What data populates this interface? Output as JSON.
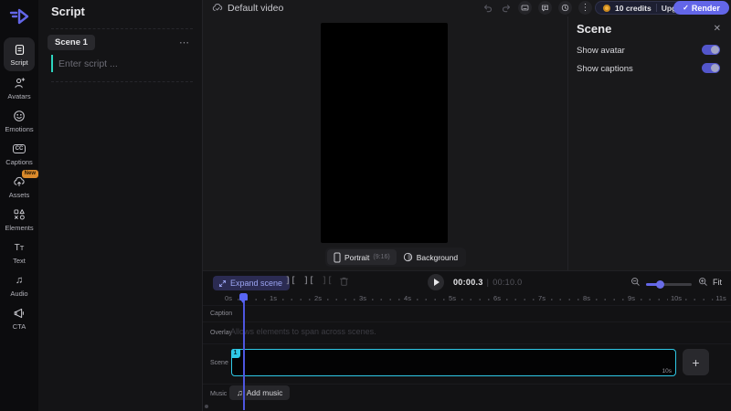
{
  "colors": {
    "accent": "#6366e8",
    "clip_cyan": "#2fc8e6",
    "coin_amber": "#f2b13d",
    "script_cursor_teal": "#2dd4bf"
  },
  "sidebar": {
    "items": [
      {
        "label": "Script"
      },
      {
        "label": "Avatars"
      },
      {
        "label": "Emotions"
      },
      {
        "label": "Captions"
      },
      {
        "label": "Assets",
        "badge": "New"
      },
      {
        "label": "Elements"
      },
      {
        "label": "Text"
      },
      {
        "label": "Audio"
      },
      {
        "label": "CTA"
      }
    ]
  },
  "script_panel": {
    "title": "Script",
    "scene_chip": "Scene 1",
    "menu_ellipsis": "⋯",
    "placeholder": "Enter script ..."
  },
  "topbar": {
    "project_name": "Default video",
    "overflow_ellipsis": "⋮",
    "credits_label": "10 credits",
    "upgrade_label": "Upgrade",
    "render_check": "✓",
    "render_label": "Render"
  },
  "stage": {
    "portrait_label": "Portrait",
    "portrait_ratio": "(9:16)",
    "background_label": "Background"
  },
  "scene_panel": {
    "title": "Scene",
    "close_glyph": "✕",
    "toggles": [
      {
        "label": "Show avatar",
        "state": "on"
      },
      {
        "label": "Show captions",
        "state": "on"
      }
    ]
  },
  "timeline": {
    "expand_button": "Expand scene",
    "trim_icon_glyph": "][",
    "current_time": "00:00.3",
    "separator": "|",
    "total_time": "00:10.0",
    "fit_label": "Fit",
    "ruler": [
      "0s",
      "1s",
      "2s",
      "3s",
      "4s",
      "5s",
      "6s",
      "7s",
      "8s",
      "9s",
      "10s",
      "11s"
    ],
    "rows": [
      {
        "label": "Caption"
      },
      {
        "label": "Overlay",
        "hint": "Allows elements to span across scenes."
      },
      {
        "label": "Scene"
      },
      {
        "label": "Music"
      }
    ],
    "scene_clip": {
      "index": "1",
      "duration": "10s"
    },
    "add_scene_glyph": "+",
    "music_note_glyph": "♫",
    "add_music_label": "Add music"
  }
}
